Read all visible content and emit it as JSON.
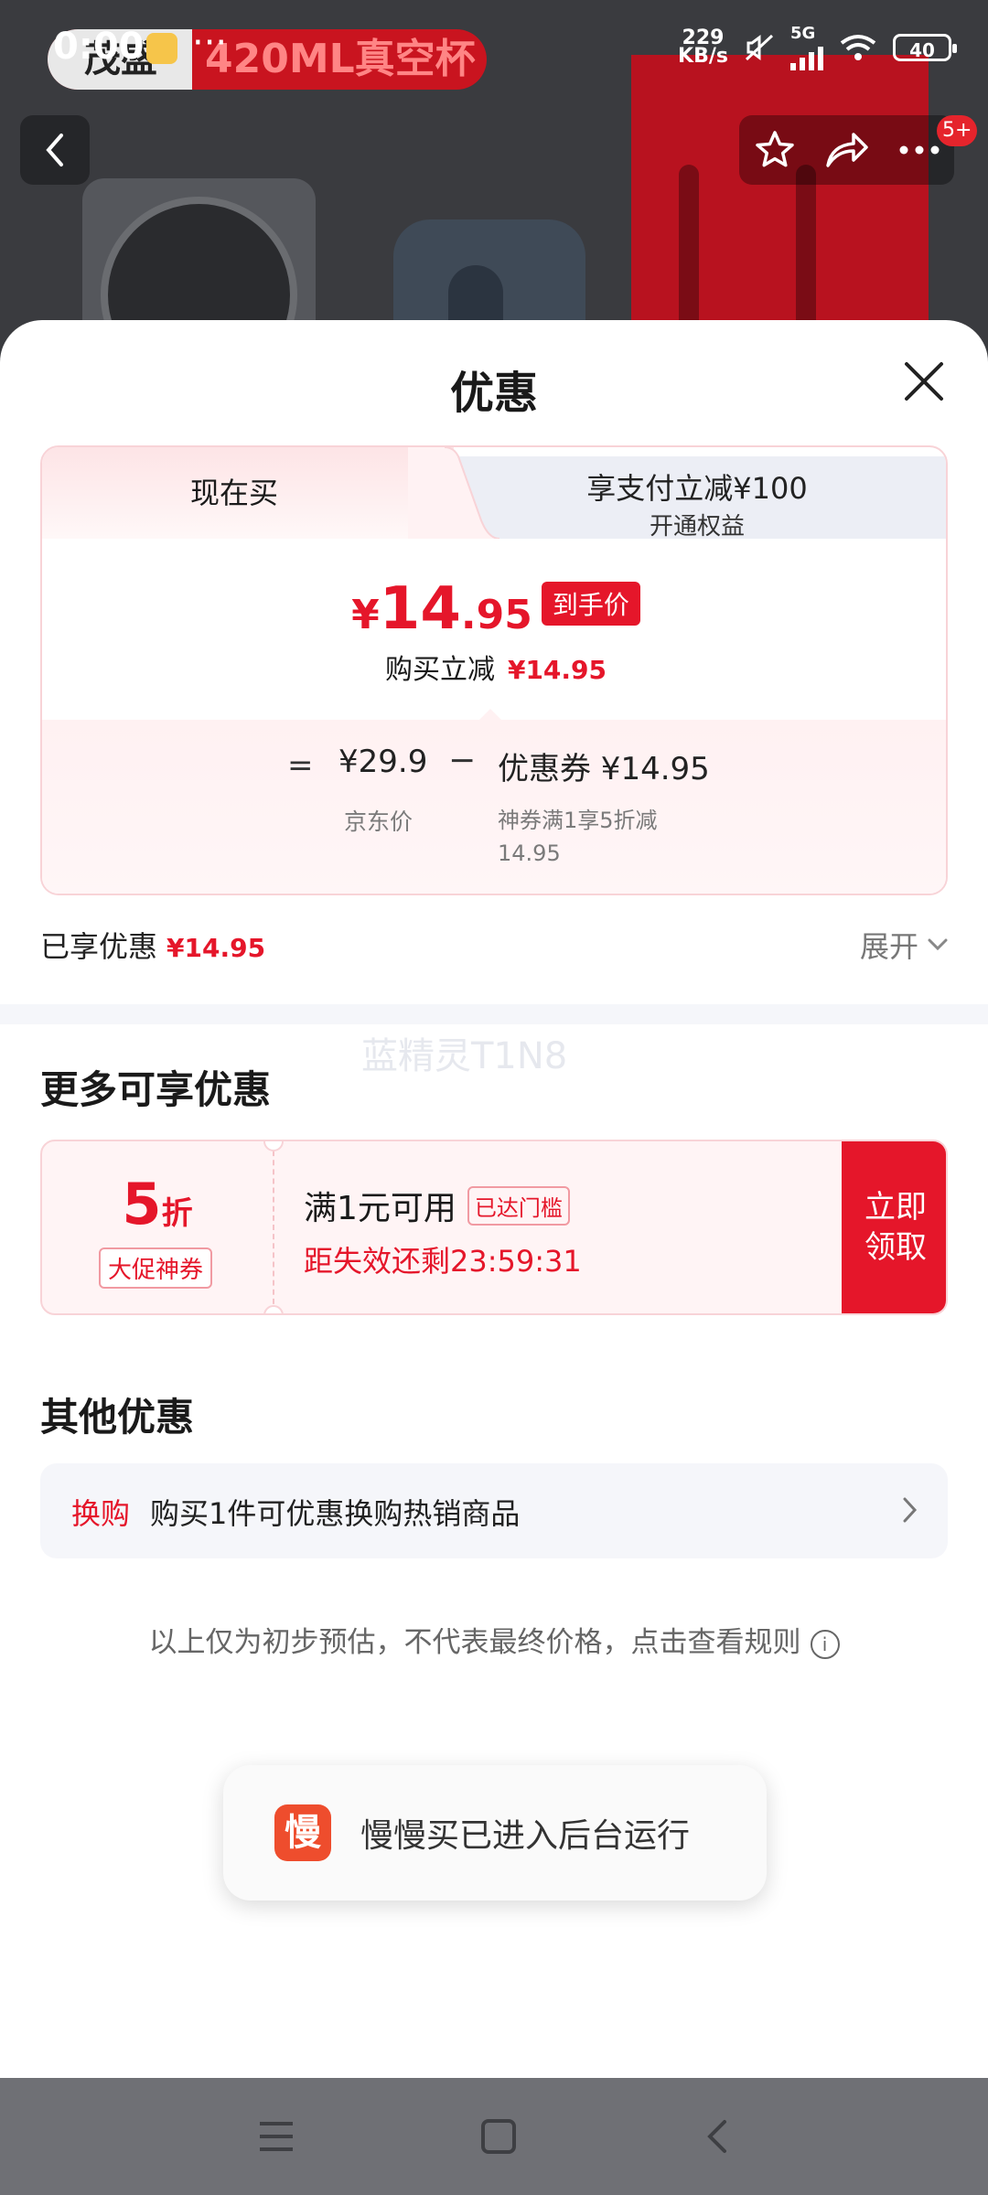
{
  "status_bar": {
    "time": "0:00",
    "more": "···",
    "net_speed_top": "229",
    "net_speed_bottom": "KB/s",
    "network": "5G",
    "battery": "40"
  },
  "product_header": {
    "title_left": "茂盛",
    "title_right": "420ML真空杯",
    "badge": "5+"
  },
  "sheet": {
    "title": "优惠",
    "tabs": {
      "now": "现在买",
      "pay_title": "享支付立减¥100",
      "pay_sub": "开通权益"
    },
    "price": {
      "currency": "¥",
      "integer": "14",
      "decimal": ".95",
      "tag": "到手价",
      "reduce_label": "购买立减",
      "reduce_value": "¥14.95"
    },
    "breakdown": {
      "equals": "=",
      "jd_price": "¥29.9",
      "minus": "−",
      "coupon": "优惠券 ¥14.95",
      "jd_label": "京东价",
      "coupon_label": "神券满1享5折减14.95"
    },
    "enjoyed_label": "已享优惠",
    "enjoyed_value": "¥14.95",
    "expand_label": "展开",
    "watermark": "蓝精灵T1N8"
  },
  "more_offers": {
    "title": "更多可享优惠",
    "coupon": {
      "discount_num": "5",
      "discount_unit": "折",
      "tag": "大促神券",
      "condition": "满1元可用",
      "reached": "已达门槛",
      "countdown": "距失效还剩23:59:31",
      "claim_line1": "立即",
      "claim_line2": "领取"
    }
  },
  "other_offers": {
    "title": "其他优惠",
    "tag": "换购",
    "text": "购买1件可优惠换购热销商品"
  },
  "disclaimer": "以上仅为初步预估，不代表最终价格，点击查看规则",
  "toast": {
    "icon_char": "慢",
    "text": "慢慢买已进入后台运行"
  },
  "colors": {
    "accent_red": "#e5162a",
    "sheet_bg": "#ffffff",
    "nav_bar": "#6f7075"
  }
}
